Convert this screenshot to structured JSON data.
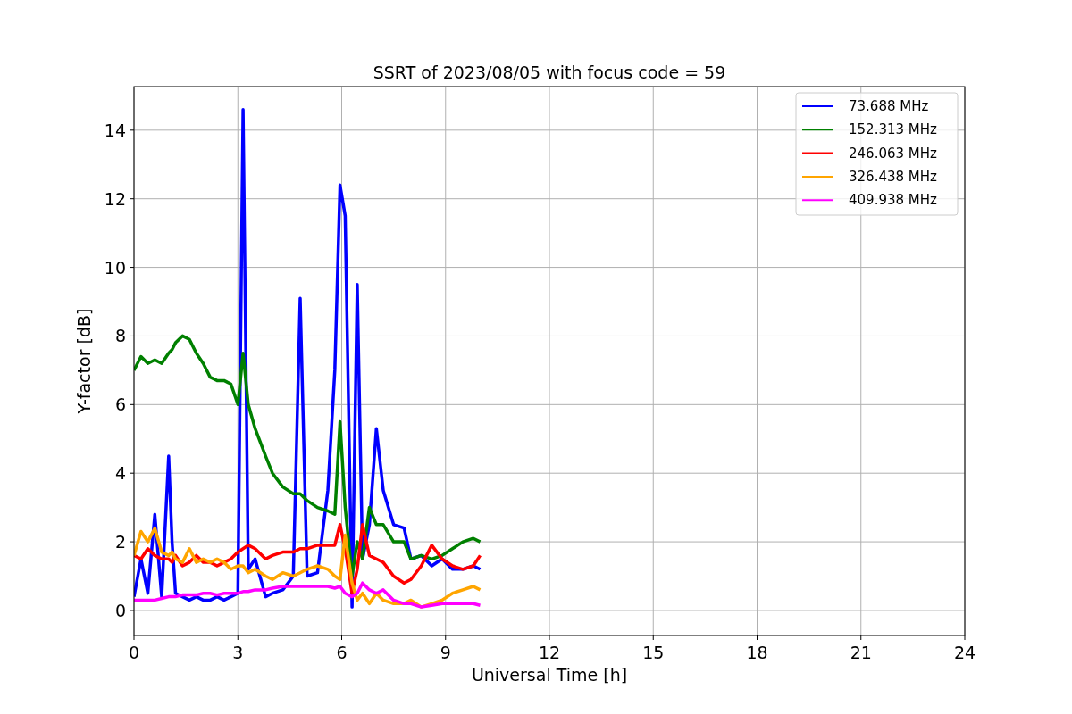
{
  "chart_data": {
    "type": "line",
    "title": "SSRT of 2023/08/05 with focus code = 59",
    "xlabel": "Universal Time [h]",
    "ylabel": "Y-factor [dB]",
    "x": [
      0,
      0.2,
      0.4,
      0.6,
      0.8,
      1.0,
      1.1,
      1.2,
      1.4,
      1.6,
      1.8,
      2.0,
      2.2,
      2.4,
      2.6,
      2.8,
      3.0,
      3.15,
      3.3,
      3.5,
      3.8,
      4.0,
      4.3,
      4.6,
      4.8,
      5.0,
      5.3,
      5.6,
      5.8,
      5.95,
      6.1,
      6.3,
      6.45,
      6.6,
      6.8,
      7.0,
      7.2,
      7.5,
      7.8,
      8.0,
      8.3,
      8.6,
      8.9,
      9.2,
      9.5,
      9.8,
      10.0
    ],
    "series": [
      {
        "name": "73.688 MHz",
        "color": "#0000ff",
        "values": [
          0.4,
          1.5,
          0.5,
          2.8,
          0.4,
          4.5,
          2.0,
          0.5,
          0.4,
          0.3,
          0.4,
          0.3,
          0.3,
          0.4,
          0.3,
          0.4,
          0.5,
          14.6,
          1.2,
          1.5,
          0.4,
          0.5,
          0.6,
          1.0,
          9.1,
          1.0,
          1.1,
          3.5,
          7.0,
          12.4,
          11.5,
          0.1,
          9.5,
          1.5,
          2.5,
          5.3,
          3.5,
          2.5,
          2.4,
          1.5,
          1.6,
          1.3,
          1.5,
          1.2,
          1.2,
          1.3,
          1.2
        ]
      },
      {
        "name": "152.313 MHz",
        "color": "#008000",
        "values": [
          7.0,
          7.4,
          7.2,
          7.3,
          7.2,
          7.5,
          7.6,
          7.8,
          8.0,
          7.9,
          7.5,
          7.2,
          6.8,
          6.7,
          6.7,
          6.6,
          6.0,
          7.5,
          6.0,
          5.3,
          4.5,
          4.0,
          3.6,
          3.4,
          3.4,
          3.2,
          3.0,
          2.9,
          2.8,
          5.5,
          3.0,
          1.0,
          2.0,
          1.5,
          3.0,
          2.5,
          2.5,
          2.0,
          2.0,
          1.5,
          1.6,
          1.5,
          1.6,
          1.8,
          2.0,
          2.1,
          2.0
        ]
      },
      {
        "name": "246.063 MHz",
        "color": "#ff0000",
        "values": [
          1.6,
          1.5,
          1.8,
          1.6,
          1.5,
          1.5,
          1.4,
          1.6,
          1.3,
          1.4,
          1.6,
          1.4,
          1.4,
          1.3,
          1.4,
          1.5,
          1.7,
          1.8,
          1.9,
          1.8,
          1.5,
          1.6,
          1.7,
          1.7,
          1.8,
          1.8,
          1.9,
          1.9,
          1.9,
          2.5,
          1.8,
          0.5,
          1.2,
          2.5,
          1.6,
          1.5,
          1.4,
          1.0,
          0.8,
          0.9,
          1.3,
          1.9,
          1.5,
          1.3,
          1.2,
          1.3,
          1.6
        ]
      },
      {
        "name": "326.438 MHz",
        "color": "#ffa500",
        "values": [
          1.6,
          2.3,
          2.0,
          2.4,
          1.7,
          1.6,
          1.7,
          1.5,
          1.4,
          1.8,
          1.4,
          1.5,
          1.4,
          1.5,
          1.4,
          1.2,
          1.3,
          1.3,
          1.1,
          1.2,
          1.0,
          0.9,
          1.1,
          1.0,
          1.1,
          1.2,
          1.3,
          1.2,
          1.0,
          0.9,
          2.2,
          0.8,
          0.3,
          0.5,
          0.2,
          0.5,
          0.3,
          0.2,
          0.2,
          0.3,
          0.1,
          0.2,
          0.3,
          0.5,
          0.6,
          0.7,
          0.6
        ]
      },
      {
        "name": "409.938 MHz",
        "color": "#ff00ff",
        "values": [
          0.3,
          0.3,
          0.3,
          0.3,
          0.35,
          0.4,
          0.4,
          0.4,
          0.45,
          0.45,
          0.45,
          0.5,
          0.5,
          0.45,
          0.5,
          0.5,
          0.5,
          0.55,
          0.55,
          0.6,
          0.6,
          0.65,
          0.7,
          0.7,
          0.7,
          0.7,
          0.7,
          0.7,
          0.65,
          0.7,
          0.5,
          0.4,
          0.5,
          0.8,
          0.6,
          0.5,
          0.6,
          0.3,
          0.2,
          0.2,
          0.1,
          0.15,
          0.2,
          0.2,
          0.2,
          0.2,
          0.15
        ]
      }
    ],
    "xlim": [
      0,
      24
    ],
    "ylim": [
      -0.73,
      15.27
    ],
    "xticks": [
      0,
      3,
      6,
      9,
      12,
      15,
      18,
      21,
      24
    ],
    "yticks": [
      0,
      2,
      4,
      6,
      8,
      10,
      12,
      14
    ],
    "grid": true,
    "legend": true
  }
}
